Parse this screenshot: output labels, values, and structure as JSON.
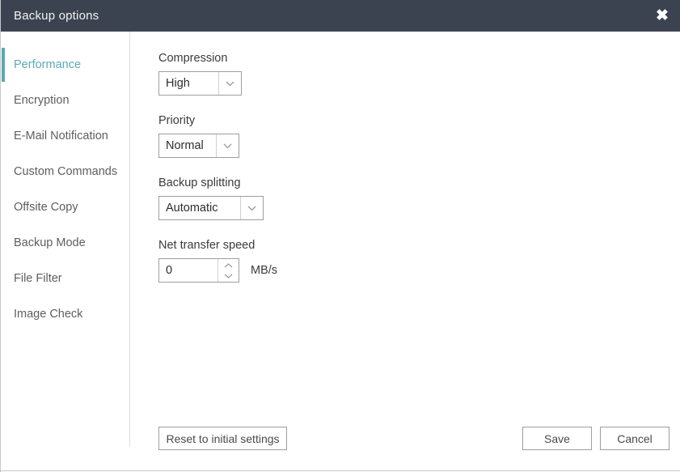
{
  "window": {
    "title": "Backup options",
    "close_icon": "close-icon",
    "titlebar_color": "#3c4350",
    "accent_color": "#5ca8b3"
  },
  "sidebar": {
    "items": [
      {
        "label": "Performance",
        "active": true
      },
      {
        "label": "Encryption",
        "active": false
      },
      {
        "label": "E-Mail Notification",
        "active": false
      },
      {
        "label": "Custom Commands",
        "active": false
      },
      {
        "label": "Offsite Copy",
        "active": false
      },
      {
        "label": "Backup Mode",
        "active": false
      },
      {
        "label": "File Filter",
        "active": false
      },
      {
        "label": "Image Check",
        "active": false
      }
    ]
  },
  "main": {
    "compression": {
      "label": "Compression",
      "value": "High",
      "arrow_icon": "chevron-down-icon"
    },
    "priority": {
      "label": "Priority",
      "value": "Normal",
      "arrow_icon": "chevron-down-icon"
    },
    "backup_splitting": {
      "label": "Backup splitting",
      "value": "Automatic",
      "arrow_icon": "chevron-down-icon"
    },
    "net_transfer_speed": {
      "label": "Net transfer speed",
      "value": "0",
      "placeholder": "0",
      "unit": "MB/s",
      "up_icon": "chevron-up-icon",
      "down_icon": "chevron-down-icon"
    }
  },
  "footer": {
    "reset_label": "Reset to initial settings",
    "save_label": "Save",
    "cancel_label": "Cancel"
  }
}
